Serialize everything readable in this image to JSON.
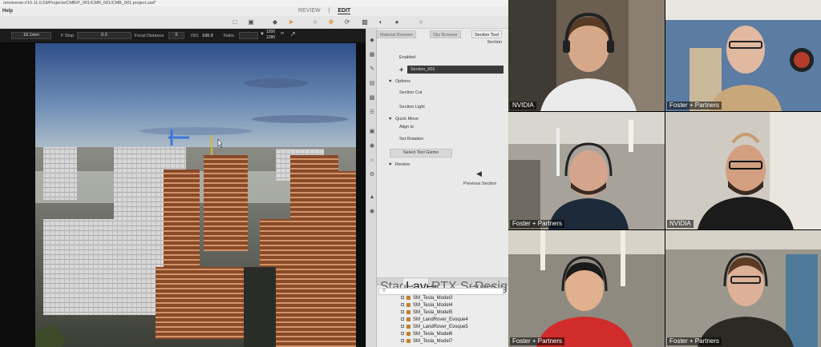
{
  "app": {
    "title_path": "omniverse://10.11.6.59/Projects/CMB/P_001/CMB_001/CMB_001.project.usd*",
    "menu_help": "Help",
    "mode_review": "REVIEW",
    "mode_separator": "|",
    "mode_edit": "EDIT"
  },
  "viewport": {
    "focal_length": "16.1mm",
    "fstop_label": "F Stop",
    "fstop_value": "0.0",
    "focus_distance_label": "Focal Distance",
    "focus_distance_value": "0",
    "iso_label": "ISO",
    "iso_value": "100.0",
    "ratio_label": "Ratio",
    "resolution_w": "1200",
    "resolution_h": "1280"
  },
  "panel": {
    "tabs": [
      "Material Browser",
      "Sky Browser",
      "Section Tool"
    ],
    "header": "Section",
    "enabled_label": "Enabled",
    "section_name": "Section_001",
    "options_label": "Options",
    "section_cut": "Section Cut",
    "section_light": "Section Light",
    "quick_move_label": "Quick Move",
    "align_to": "Align to",
    "set_rotation": "Set Rotation",
    "select_tool_gizmo": "Select Tool Gizmo",
    "review_label": "Review",
    "previous_section": "Previous Section",
    "bottom_tabs": [
      "Stage",
      "Layer",
      "RTX Settings",
      "Design Review"
    ],
    "layers": [
      "SM_Tesla_Model3",
      "SM_Tesla_Model4",
      "SM_Tesla_Model5",
      "SM_LandRover_Evoque4",
      "SM_LandRover_Evoque5",
      "SM_Tesla_Model6",
      "SM_Tesla_Model7"
    ]
  },
  "participants": [
    {
      "name": "NVIDIA"
    },
    {
      "name": "Foster + Partners"
    },
    {
      "name": "Foster + Partners"
    },
    {
      "name": "NVIDIA"
    },
    {
      "name": "Foster + Partners"
    },
    {
      "name": "Foster + Partners"
    }
  ]
}
